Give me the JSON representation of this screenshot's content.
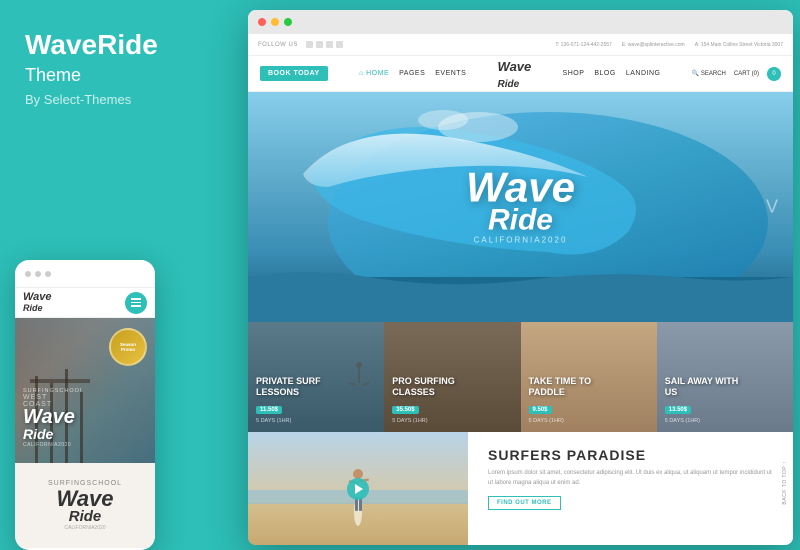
{
  "brand": {
    "title": "WaveRide",
    "subtitle": "Theme",
    "author": "By Select-Themes"
  },
  "mobile": {
    "logo": "Wave\nRide",
    "hero_logo": "Wave\nRide",
    "sub_text": "CALIFORNIA2020"
  },
  "desktop": {
    "topbar": {
      "follow_label": "FOLLOW US",
      "phone": "T: 136-071-124-442-2557",
      "email": "E: wave@splinteractive.com",
      "address": "A: 154 Main Collins Street Victoria 3007"
    },
    "navbar": {
      "book_btn": "BOOK TODAY",
      "links": [
        "HOME",
        "PAGES",
        "EVENTS",
        "SHOP",
        "BLOG",
        "LANDING"
      ],
      "search": "SEARCH",
      "cart": "CART (0)",
      "cart_count": "0"
    },
    "hero": {
      "logo_line1": "Wave",
      "logo_line2": "Ride",
      "sub": "CALIFORNIA2020"
    },
    "cards": [
      {
        "title": "PRIVATE SURF\nLESSONS",
        "price": "11.50$",
        "info": "5 DAYS (1HR)",
        "bg_color": "#5a7a8a"
      },
      {
        "title": "PRO SURFING\nCLASSES",
        "price": "35.50$",
        "info": "5 DAYS (1HR)",
        "bg_color": "#8a7a6a"
      },
      {
        "title": "TAKE TIME TO\nPADDLE",
        "price": "9.50$",
        "info": "5 DAYS (1HR)",
        "bg_color": "#c4a882"
      },
      {
        "title": "SAIL AWAY WITH\nUS",
        "price": "13.50$",
        "info": "5 DAYS (1HR)",
        "bg_color": "#7a8a9a"
      }
    ],
    "bottom": {
      "section_title": "SURFERS PARADISE",
      "body_text": "Lorem ipsum dolor sit amet, consectetur adipiscing elit. Ut duis ex aliqua, ut aliquam ut tempor incididunt ut ut labore magna aliqua ut enim ad.",
      "find_out_btn": "FIND OUT MORE"
    }
  }
}
